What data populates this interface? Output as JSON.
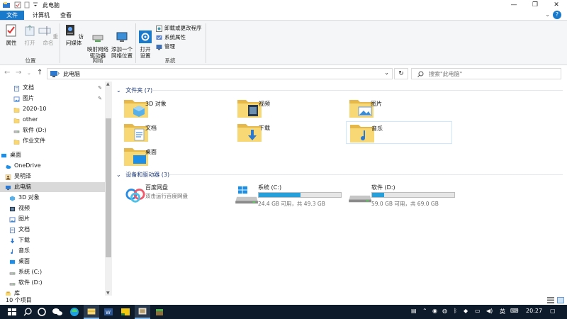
{
  "window": {
    "title": "此电脑",
    "controls": {
      "minimize": "—",
      "maximize": "❐",
      "close": "✕"
    }
  },
  "ribbon": {
    "tabs": [
      "文件",
      "计算机",
      "查看"
    ],
    "location_group": {
      "label": "位置",
      "buttons": [
        "属性",
        "打开",
        "重命名"
      ]
    },
    "network_group": {
      "label": "网络",
      "buttons": [
        "访问媒体",
        "映射网络\n驱动器",
        "添加一个\n网络位置"
      ]
    },
    "system_group": {
      "label": "系统",
      "open_settings": "打开\n设置",
      "items": [
        "卸载或更改程序",
        "系统属性",
        "管理"
      ]
    }
  },
  "address": {
    "path": "此电脑",
    "search_placeholder": "搜索\"此电脑\""
  },
  "nav_pane": {
    "items": [
      {
        "label": "文档",
        "icon": "documents-icon",
        "pinned": true
      },
      {
        "label": "图片",
        "icon": "pictures-icon",
        "pinned": true
      },
      {
        "label": "2020-10",
        "icon": "folder-icon",
        "pinned": false
      },
      {
        "label": "other",
        "icon": "folder-icon",
        "pinned": false
      },
      {
        "label": "软件 (D:)",
        "icon": "drive-icon",
        "pinned": false
      },
      {
        "label": "作业文件",
        "icon": "folder-icon",
        "pinned": false
      },
      {
        "label": "桌面",
        "icon": "desktop-icon",
        "pinned": false
      },
      {
        "label": "OneDrive",
        "icon": "onedrive-icon",
        "pinned": false
      },
      {
        "label": "吴明泽",
        "icon": "user-icon",
        "pinned": false
      },
      {
        "label": "此电脑",
        "icon": "computer-icon",
        "pinned": false,
        "selected": true
      },
      {
        "label": "3D 对象",
        "icon": "3d-objects-icon",
        "pinned": false
      },
      {
        "label": "视频",
        "icon": "videos-icon",
        "pinned": false
      },
      {
        "label": "图片",
        "icon": "pictures-icon",
        "pinned": false
      },
      {
        "label": "文档",
        "icon": "documents-icon",
        "pinned": false
      },
      {
        "label": "下载",
        "icon": "downloads-icon",
        "pinned": false
      },
      {
        "label": "音乐",
        "icon": "music-icon",
        "pinned": false
      },
      {
        "label": "桌面",
        "icon": "desktop-icon",
        "pinned": false
      },
      {
        "label": "系统 (C:)",
        "icon": "drive-icon",
        "pinned": false
      },
      {
        "label": "软件 (D:)",
        "icon": "drive-icon",
        "pinned": false
      },
      {
        "label": "库",
        "icon": "library-icon",
        "pinned": false
      }
    ]
  },
  "content": {
    "folders_header": "文件夹 (7)",
    "folders": [
      {
        "label": "3D 对象",
        "icon": "3d-objects-folder-icon"
      },
      {
        "label": "视频",
        "icon": "videos-folder-icon"
      },
      {
        "label": "图片",
        "icon": "pictures-folder-icon"
      },
      {
        "label": "文档",
        "icon": "documents-folder-icon"
      },
      {
        "label": "下载",
        "icon": "downloads-folder-icon"
      },
      {
        "label": "音乐",
        "icon": "music-folder-icon"
      },
      {
        "label": "桌面",
        "icon": "desktop-folder-icon"
      }
    ],
    "devices_header": "设备和驱动器 (3)",
    "devices": [
      {
        "name": "百度网盘",
        "info": "双击运行百度网盘",
        "icon": "baidu-netdisk-icon"
      },
      {
        "name": "系统 (C:)",
        "info": "24.4 GB 可用，共 49.3 GB",
        "used_fraction": 0.505,
        "icon": "windows-drive-icon"
      },
      {
        "name": "软件 (D:)",
        "info": "59.0 GB 可用，共 69.0 GB",
        "used_fraction": 0.145,
        "icon": "hdd-drive-icon"
      }
    ]
  },
  "status": {
    "count": "10 个项目"
  },
  "taskbar": {
    "tray_lang": "英",
    "time": "20:27"
  },
  "colors": {
    "accent": "#1979ca",
    "drive_fill": "#26a0da",
    "folder": "#f8d775"
  }
}
